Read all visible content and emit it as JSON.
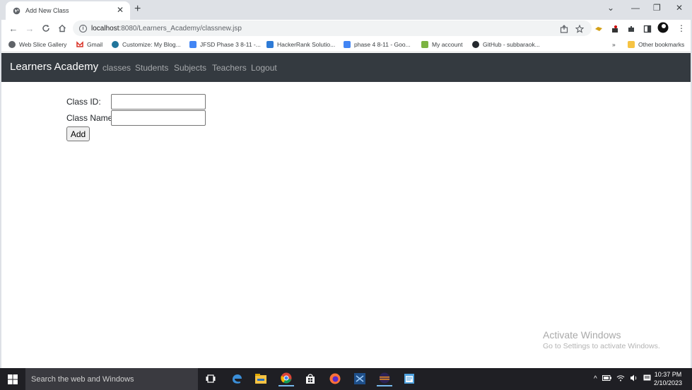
{
  "browser": {
    "tab_title": "Add New Class",
    "url_host": "localhost",
    "url_path": ":8080/Learners_Academy/classnew.jsp",
    "bookmarks": [
      "Web Slice Gallery",
      "Gmail",
      "Customize: My Blog...",
      "JFSD Phase 3 8-11 -...",
      "HackerRank Solutio...",
      "phase 4 8-11 - Goo...",
      "My account",
      "GitHub - subbaraok...",
      "Other bookmarks"
    ],
    "overflow_label": "»"
  },
  "navbar": {
    "brand": "Learners Academy",
    "links": [
      "classes",
      "Students",
      "Subjects",
      "Teachers",
      "Logout"
    ]
  },
  "form": {
    "class_id_label": "Class ID:",
    "class_id_value": "",
    "class_name_label": "Class Name:",
    "class_name_value": "",
    "submit_label": "Add"
  },
  "watermark": {
    "title": "Activate Windows",
    "subtitle": "Go to Settings to activate Windows."
  },
  "taskbar": {
    "search_placeholder": "Search the web and Windows",
    "time": "10:37 PM",
    "date": "2/10/2023"
  },
  "colors": {
    "navbar_bg": "#343a40",
    "tab_strip": "#dee1e6",
    "taskbar_bg": "#1f1f24"
  }
}
